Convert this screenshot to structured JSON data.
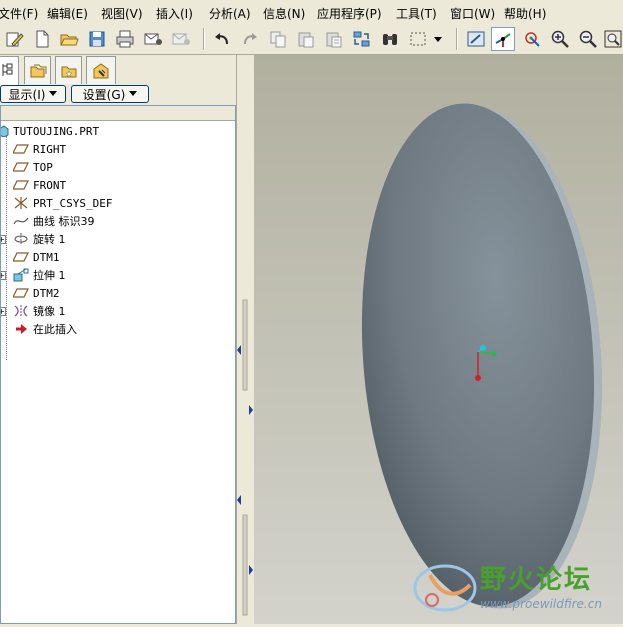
{
  "menu": {
    "items": [
      {
        "label": "文件(F)",
        "name": "menu-file"
      },
      {
        "label": "编辑(E)",
        "name": "menu-edit"
      },
      {
        "label": "视图(V)",
        "name": "menu-view"
      },
      {
        "label": "插入(I)",
        "name": "menu-insert"
      },
      {
        "label": "分析(A)",
        "name": "menu-analysis"
      },
      {
        "label": "信息(N)",
        "name": "menu-info"
      },
      {
        "label": "应用程序(P)",
        "name": "menu-applications"
      },
      {
        "label": "工具(T)",
        "name": "menu-tools"
      },
      {
        "label": "窗口(W)",
        "name": "menu-window"
      },
      {
        "label": "帮助(H)",
        "name": "menu-help"
      }
    ]
  },
  "toolbar": {
    "buttons": [
      "edit-icon",
      "new-file-icon",
      "open-folder-icon",
      "save-icon",
      "print-icon",
      "send-mail-icon",
      "send-mail-disabled-icon",
      "undo-icon",
      "redo-icon",
      "copy-icon",
      "paste-icon",
      "paste-special-icon",
      "regenerate-icon",
      "search-binoculars-icon",
      "selection-box-icon",
      "dropdown-arrow-icon",
      "repaint-icon",
      "spin-center-icon",
      "orient-mode-icon",
      "zoom-in-icon",
      "zoom-out-icon",
      "refit-icon"
    ]
  },
  "panel": {
    "show_button": "显示(I)",
    "settings_button": "设置(G)"
  },
  "tree": {
    "root": "TUTOUJING.PRT",
    "items": [
      {
        "label": "RIGHT",
        "icon": "datum-plane-icon",
        "expandable": false
      },
      {
        "label": "TOP",
        "icon": "datum-plane-icon",
        "expandable": false
      },
      {
        "label": "FRONT",
        "icon": "datum-plane-icon",
        "expandable": false
      },
      {
        "label": "PRT_CSYS_DEF",
        "icon": "csys-icon",
        "expandable": false
      },
      {
        "label": "曲线 标识39",
        "icon": "curve-icon",
        "expandable": false
      },
      {
        "label": "旋转 1",
        "icon": "revolve-icon",
        "expandable": true
      },
      {
        "label": "DTM1",
        "icon": "datum-plane-icon",
        "expandable": false
      },
      {
        "label": "拉伸 1",
        "icon": "extrude-icon",
        "expandable": true
      },
      {
        "label": "DTM2",
        "icon": "datum-plane-icon",
        "expandable": false
      },
      {
        "label": "镜像 1",
        "icon": "mirror-icon",
        "expandable": true
      },
      {
        "label": "在此插入",
        "icon": "insert-here-arrow-icon",
        "expandable": false
      }
    ]
  },
  "watermark": {
    "title": "野火论坛",
    "url": "www.proewildfire.cn"
  },
  "colors": {
    "model": "#6f7a83",
    "viewport_top": "#b1b09f",
    "viewport_bottom": "#d3d3cc",
    "watermark_green": "#4aa02e"
  }
}
